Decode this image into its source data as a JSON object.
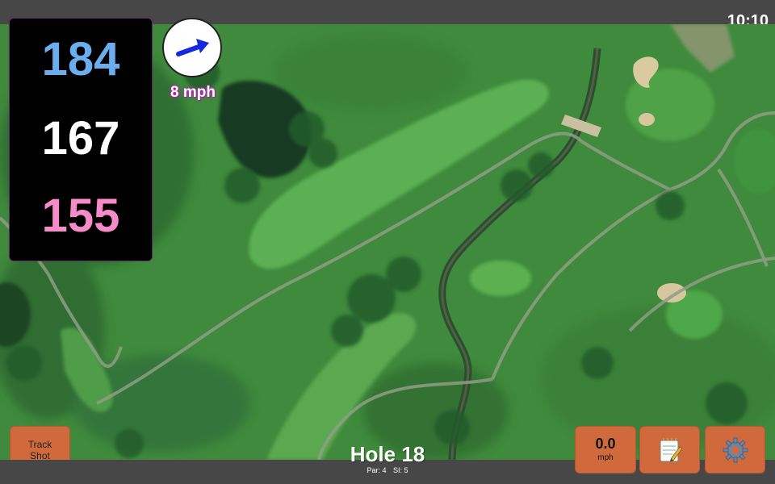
{
  "status_bar": {
    "time": "10:10"
  },
  "distances": {
    "back": "184",
    "middle": "167",
    "front": "155"
  },
  "wind": {
    "speed_label": "8 mph",
    "arrow_color": "#1428e0"
  },
  "buttons": {
    "track_shot_line1": "Track",
    "track_shot_line2": "Shot",
    "speed_value": "0.0",
    "speed_unit": "mph",
    "notes_icon": "notepad-icon",
    "settings_icon": "gear-icon"
  },
  "hole": {
    "title": "Hole 18",
    "par": "Par: 4",
    "si": "SI: 5"
  },
  "colors": {
    "back_distance": "#6aaef0",
    "middle_distance": "#ffffff",
    "front_distance": "#f78ac8",
    "button": "#d06a3c"
  }
}
